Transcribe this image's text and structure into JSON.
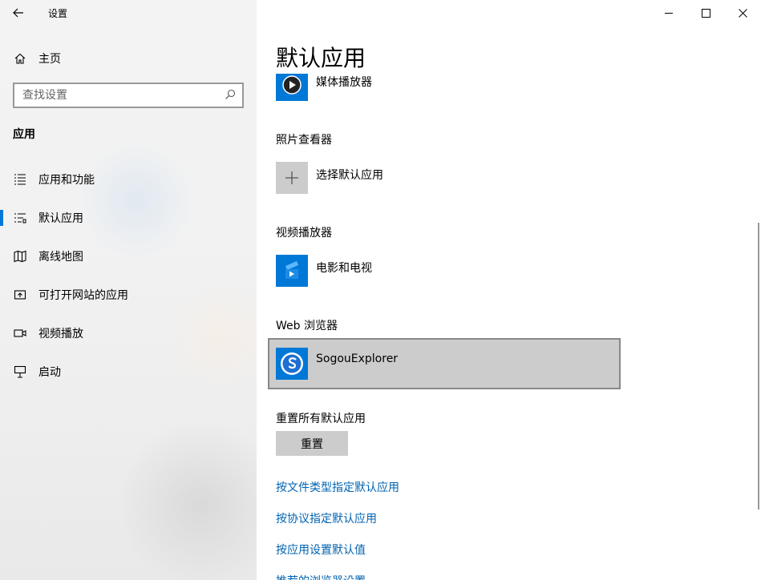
{
  "window": {
    "title": "设置",
    "back_icon": "←",
    "minimize_icon": "—",
    "maximize_icon": "☐",
    "close_icon": "✕"
  },
  "sidebar": {
    "home_label": "主页",
    "search_placeholder": "查找设置",
    "section_title": "应用",
    "items": [
      {
        "label": "应用和功能",
        "icon": "apps-features-icon"
      },
      {
        "label": "默认应用",
        "icon": "default-apps-icon",
        "active": true
      },
      {
        "label": "离线地图",
        "icon": "offline-maps-icon"
      },
      {
        "label": "可打开网站的应用",
        "icon": "apps-for-websites-icon"
      },
      {
        "label": "视频播放",
        "icon": "video-playback-icon"
      },
      {
        "label": "启动",
        "icon": "startup-icon"
      }
    ]
  },
  "main": {
    "page_title": "默认应用",
    "partial_row_label": "媒体播放器",
    "groups": [
      {
        "label": "照片查看器",
        "app": "选择默认应用"
      },
      {
        "label": "视频播放器",
        "app": "电影和电视"
      },
      {
        "label": "Web 浏览器",
        "app": "SogouExplorer"
      }
    ],
    "reset_label": "重置所有默认应用",
    "reset_button": "重置",
    "links": [
      "按文件类型指定默认应用",
      "按协议指定默认应用",
      "按应用设置默认值",
      "推荐的浏览器设置"
    ]
  },
  "colors": {
    "accent": "#0078d7",
    "link": "#0063b1",
    "tile_blue": "#0078d7",
    "selection_bg": "#cccccc"
  }
}
